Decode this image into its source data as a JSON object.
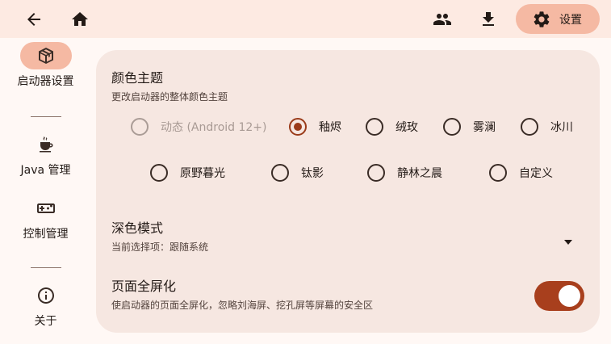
{
  "topbar": {
    "back_icon": "arrow-back-icon",
    "home_icon": "home-icon",
    "accounts_icon": "people-icon",
    "download_icon": "download-icon",
    "settings_icon": "gear-icon",
    "settings_label": "设置"
  },
  "rail": {
    "items": [
      {
        "label": "启动器设置",
        "icon": "cube-icon",
        "active": true
      },
      {
        "label": "Java 管理",
        "icon": "java-cup-icon",
        "active": false
      },
      {
        "label": "控制管理",
        "icon": "gamepad-icon",
        "active": false
      },
      {
        "label": "关于",
        "icon": "info-icon",
        "active": false
      }
    ]
  },
  "content": {
    "color_theme": {
      "title": "颜色主题",
      "subtitle": "更改启动器的整体颜色主题",
      "options": [
        {
          "label": "动态 (Android 12+)",
          "state": "disabled"
        },
        {
          "label": "釉烬",
          "state": "checked"
        },
        {
          "label": "绒玫",
          "state": "unchecked"
        },
        {
          "label": "雾澜",
          "state": "unchecked"
        },
        {
          "label": "冰川",
          "state": "unchecked"
        },
        {
          "label": "原野暮光",
          "state": "unchecked"
        },
        {
          "label": "钛影",
          "state": "unchecked"
        },
        {
          "label": "静林之晨",
          "state": "unchecked"
        },
        {
          "label": "自定义",
          "state": "unchecked"
        }
      ]
    },
    "dark_mode": {
      "title": "深色模式",
      "current": "当前选择项：跟随系统"
    },
    "fullscreen": {
      "title": "页面全屏化",
      "subtitle": "使启动器的页面全屏化，忽略刘海屏、挖孔屏等屏幕的安全区",
      "enabled": true
    }
  },
  "colors": {
    "accent": "#a83f1d",
    "accent_container": "#f5b9a3",
    "background": "#fff8f5",
    "card": "#f6e7e1"
  }
}
